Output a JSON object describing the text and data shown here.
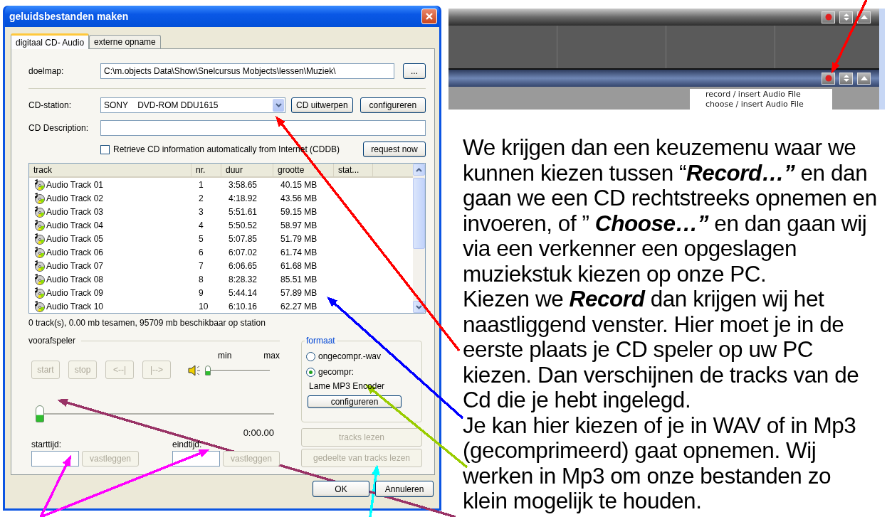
{
  "dialog": {
    "title": "geluidsbestanden maken",
    "tabs": [
      {
        "label": "digitaal CD- Audio",
        "selected": true
      },
      {
        "label": "externe opname",
        "selected": false
      }
    ],
    "target_folder": {
      "label": "doelmap:",
      "value": "C:\\m.objects Data\\Show\\Snelcursus Mobjects\\lessen\\Muziek\\",
      "browse_button": "..."
    },
    "cd_station": {
      "label": "CD-station:",
      "value": "SONY    DVD-ROM DDU1615",
      "eject_button": "CD uitwerpen",
      "configure_button": "configureren"
    },
    "cd_description": {
      "label": "CD Description:"
    },
    "cddb": {
      "label": "Retrieve CD information automatically from Internet (CDDB)",
      "checked": false,
      "button": "request now"
    },
    "track_list": {
      "columns": [
        "track",
        "nr.",
        "duur",
        "grootte",
        "stat..."
      ],
      "rows": [
        {
          "track": "Audio Track 01",
          "nr": "1",
          "duration": "3:58.65",
          "size": "40.15 MB"
        },
        {
          "track": "Audio Track 02",
          "nr": "2",
          "duration": "4:18.92",
          "size": "43.56 MB"
        },
        {
          "track": "Audio Track 03",
          "nr": "3",
          "duration": "5:51.61",
          "size": "59.15 MB"
        },
        {
          "track": "Audio Track 04",
          "nr": "4",
          "duration": "5:50.52",
          "size": "58.97 MB"
        },
        {
          "track": "Audio Track 05",
          "nr": "5",
          "duration": "5:07.85",
          "size": "51.79 MB"
        },
        {
          "track": "Audio Track 06",
          "nr": "6",
          "duration": "6:07.02",
          "size": "61.74 MB"
        },
        {
          "track": "Audio Track 07",
          "nr": "7",
          "duration": "6:06.65",
          "size": "61.68 MB"
        },
        {
          "track": "Audio Track 08",
          "nr": "8",
          "duration": "8:28.32",
          "size": "85.51 MB"
        },
        {
          "track": "Audio Track 09",
          "nr": "9",
          "duration": "5:44.14",
          "size": "57.89 MB"
        },
        {
          "track": "Audio Track 10",
          "nr": "10",
          "duration": "6:10.16",
          "size": "62.27 MB"
        }
      ]
    },
    "status": "0 track(s),  0.00 mb tesamen, 95709 mb beschikbaar op station",
    "preview": {
      "title": "voorafspeler",
      "buttons": [
        {
          "label": "start",
          "disabled": true
        },
        {
          "label": "stop",
          "disabled": true
        },
        {
          "label": "<--|",
          "disabled": true
        },
        {
          "label": "|-->",
          "disabled": true
        }
      ],
      "volume": {
        "min_label": "min",
        "max_label": "max",
        "level": 0
      },
      "position": {
        "level": 0
      },
      "time": "0:00.00",
      "start_time": {
        "label": "starttijd:",
        "button": {
          "label": "vastleggen",
          "disabled": true
        }
      },
      "end_time": {
        "label": "eindtijd:",
        "button": {
          "label": "vastleggen",
          "disabled": true
        }
      }
    },
    "format": {
      "title": "formaat",
      "options": [
        {
          "label": "ongecompr.-wav",
          "selected": false
        },
        {
          "label": "gecompr:",
          "selected": true
        }
      ],
      "encoder": "Lame MP3 Encoder",
      "configure_button": "configureren"
    },
    "read_buttons": [
      {
        "label": "tracks lezen",
        "disabled": true
      },
      {
        "label": "gedeelte van tracks lezen",
        "disabled": true
      }
    ],
    "footer_buttons": [
      "OK",
      "Annuleren"
    ]
  },
  "app_screenshot": {
    "menu": [
      "record / insert Audio File",
      "choose / insert Audio File"
    ]
  },
  "paragraphs": [
    "We krijgen dan een keuzemenu waar we kunnen kiezen tussen “**Record…”** en dan gaan we een CD rechtstreeks opnemen en invoeren, of ” **Choose…”** en dan gaan wij via een verkenner een opgeslagen muziekstuk kiezen op onze PC.",
    "Kiezen we **Record** dan krijgen wij het naastliggend venster. Hier moet je in de eerste plaats je CD speler op uw PC kiezen. Dan verschijnen de tracks van de Cd die je hebt ingelegd.",
    "Je kan hier kiezen of je in WAV of in Mp3 (gecomprimeerd) gaat opnemen. Wij werken in Mp3 om onze bestanden zo klein mogelijk te houden."
  ],
  "annotation_arrows": [
    {
      "color": "#ff0000"
    },
    {
      "color": "#ff0000"
    },
    {
      "color": "#0000ff"
    },
    {
      "color": "#99cc00"
    },
    {
      "color": "#ff00ff"
    },
    {
      "color": "#ff00ff"
    },
    {
      "color": "#00ffff"
    },
    {
      "color": "#993366"
    }
  ]
}
